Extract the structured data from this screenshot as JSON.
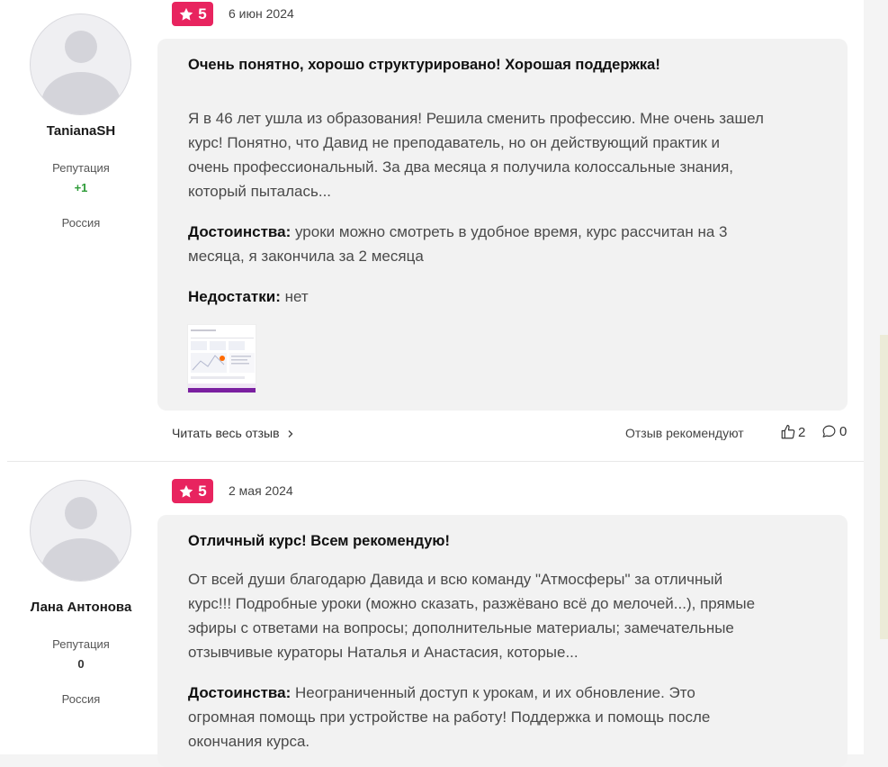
{
  "colors": {
    "rating_bg": "#e8245f",
    "rep_positive": "#2e9c38",
    "rep_neutral": "#333333"
  },
  "reviews": [
    {
      "user": {
        "name": "TanianaSH",
        "rep_label": "Репутация",
        "rep_value": "+1",
        "country": "Россия"
      },
      "rating": "5",
      "date": "6 июн 2024",
      "title": "Очень понятно, хорошо структурировано! Хорошая поддержка!",
      "text_lines": [
        "Я в 46 лет ушла из образования! Решила сменить профессию. Мне очень зашел",
        "курс! Понятно, что Давид не преподаватель, но он действующий практик и",
        "очень профессиональный. За два месяца я получила колоссальные знания,",
        "который пыталась..."
      ],
      "pros_label": "Достоинства:",
      "pros_lines": [
        "уроки можно смотреть в удобное время, курс рассчитан на 3",
        "месяца, я закончила за 2 месяца"
      ],
      "cons_label": "Недостатки:",
      "cons_text": "нет",
      "read_more": "Читать весь отзыв",
      "recommend_label": "Отзыв рекомендуют",
      "likes": "2",
      "comments": "0"
    },
    {
      "user": {
        "name": "Лана Антонова",
        "rep_label": "Репутация",
        "rep_value": "0",
        "country": "Россия"
      },
      "rating": "5",
      "date": "2 мая 2024",
      "title": "Отличный курс! Всем рекомендую!",
      "text_lines": [
        "От всей души благодарю Давида и всю команду \"Атмосферы\" за отличный",
        "курс!!! Подробные уроки (можно сказать, разжёвано всё до мелочей...), прямые",
        "эфиры с ответами на вопросы; дополнительные материалы; замечательные",
        "отзывчивые кураторы Наталья и Анастасия, которые..."
      ],
      "pros_label": "Достоинства:",
      "pros_lines": [
        "Неограниченный доступ к урокам, и их обновление. Это",
        "огромная помощь при устройстве на работу! Поддержка и помощь после",
        "окончания курса."
      ]
    }
  ]
}
